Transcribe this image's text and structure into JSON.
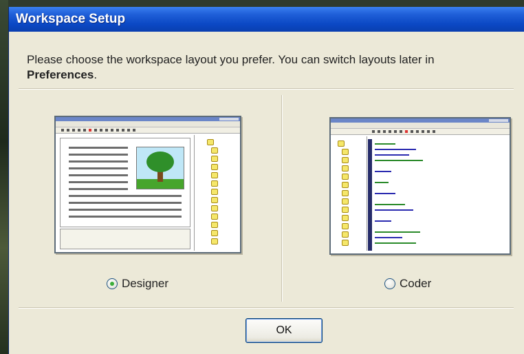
{
  "dialog": {
    "title": "Workspace Setup",
    "prompt_text": "Please choose the workspace layout you prefer. You can switch layouts later in",
    "prompt_bold": "Preferences"
  },
  "layouts": [
    {
      "id": "designer",
      "label": "Designer",
      "selected": true
    },
    {
      "id": "coder",
      "label": "Coder",
      "selected": false
    }
  ],
  "buttons": {
    "ok_label": "OK"
  },
  "colors": {
    "titlebar": "#0b48c4",
    "dialog_bg": "#ece9d8",
    "radio_selected_dot": "#3cae3a",
    "code_gutter": "#262c6a",
    "tree_node": "#f5e76a"
  }
}
